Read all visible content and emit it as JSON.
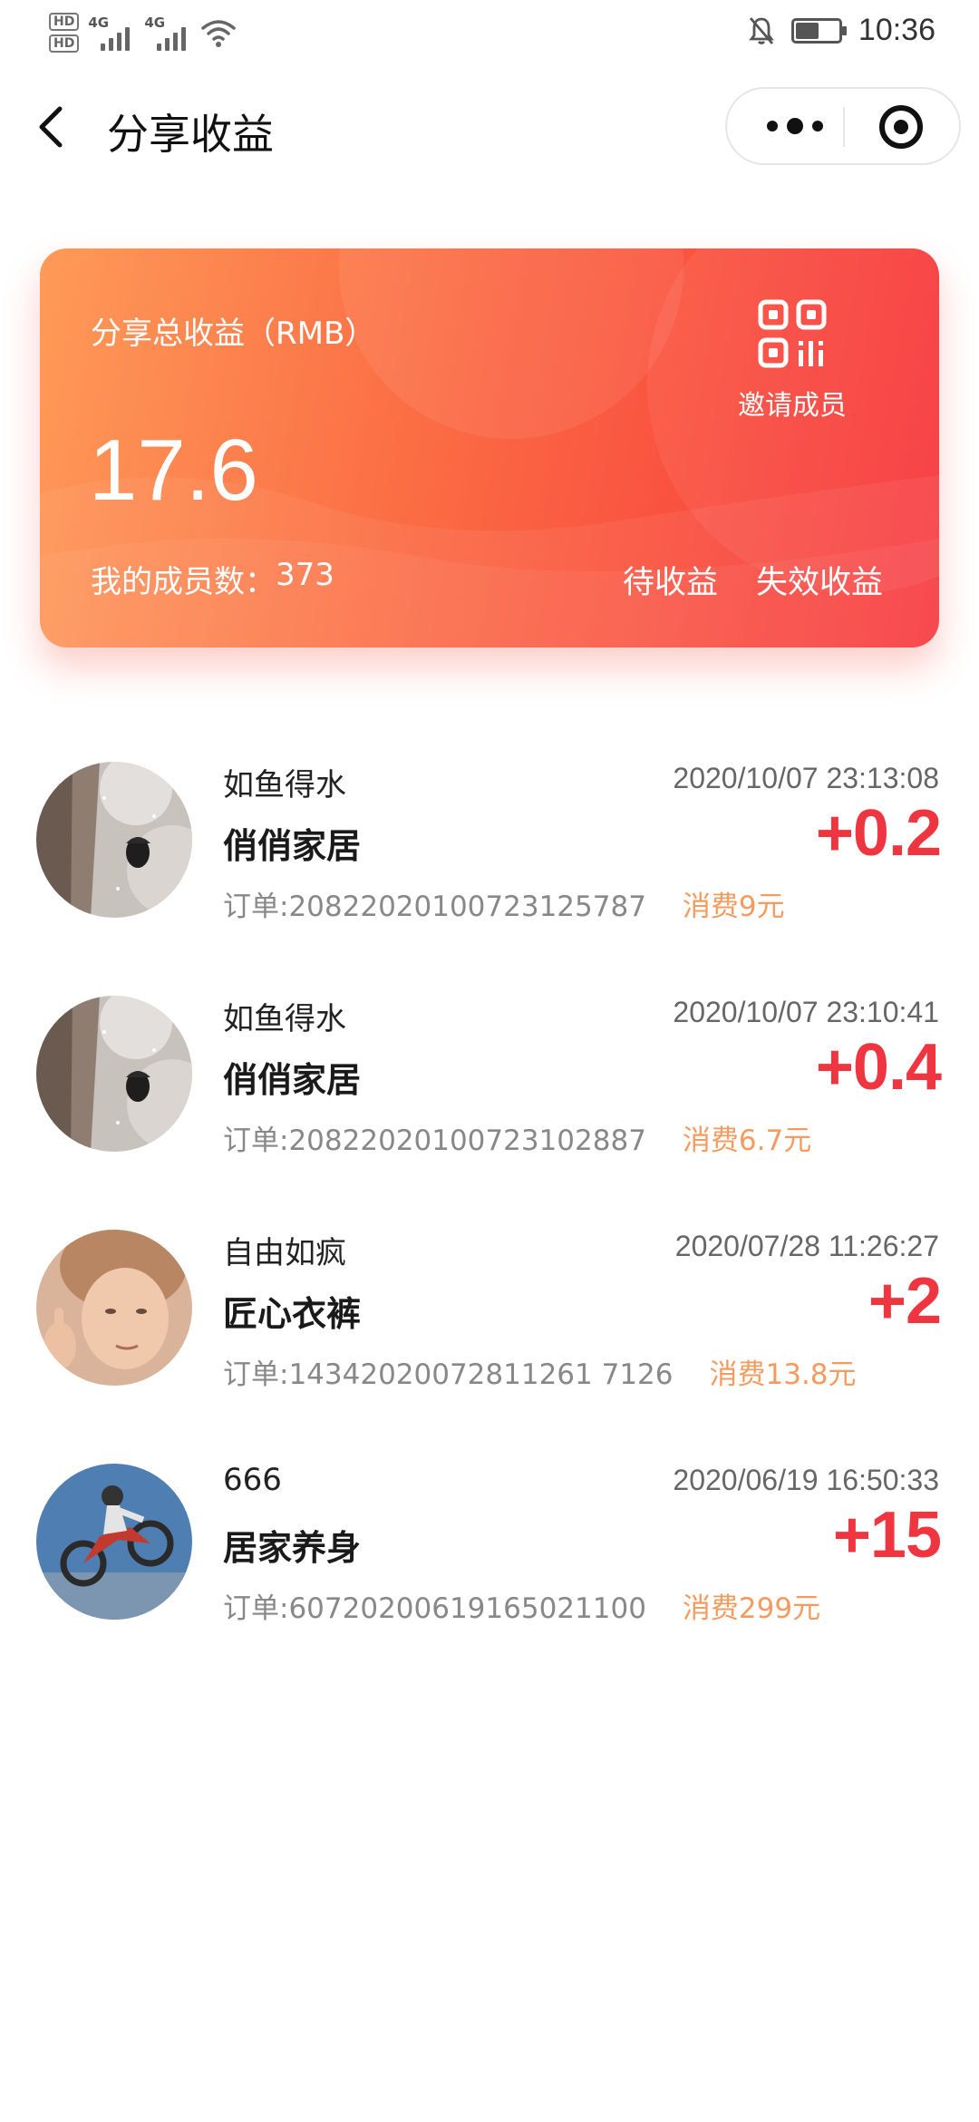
{
  "status_bar": {
    "hd1": "HD",
    "hd2": "HD",
    "net1": "4G",
    "net2": "4G",
    "time": "10:36",
    "battery_level": 0.55
  },
  "nav": {
    "title": "分享收益",
    "icons": [
      "back-arrow-icon",
      "more-dots-icon",
      "target-icon"
    ]
  },
  "summary": {
    "label": "分享总收益（RMB）",
    "amount": "17.6",
    "members_label": "我的成员数：",
    "members_count": "373",
    "invite_label": "邀请成员",
    "pending_label": "待收益",
    "expired_label": "失效收益",
    "colors": {
      "gradient_start": "#fe9a58",
      "gradient_end": "#f7353c"
    }
  },
  "records": [
    {
      "name": "如鱼得水",
      "date": "2020/10/07 23:13:08",
      "shop": "俏俏家居",
      "amount": "+0.2",
      "order_label": "订单:",
      "order_no": "20822020100723125787",
      "spend": "消费9元",
      "avatar": "snow-tree-avatar"
    },
    {
      "name": "如鱼得水",
      "date": "2020/10/07 23:10:41",
      "shop": "俏俏家居",
      "amount": "+0.4",
      "order_label": "订单:",
      "order_no": "20822020100723102887",
      "spend": "消费6.7元",
      "avatar": "snow-tree-avatar"
    },
    {
      "name": "自由如疯",
      "date": "2020/07/28 11:26:27",
      "shop": "匠心衣裤",
      "amount": "+2",
      "order_label": "订单:",
      "order_no": "14342020072811261 7126",
      "spend": "消费13.8元",
      "avatar": "child-thumbs-up-avatar"
    },
    {
      "name": "666",
      "date": "2020/06/19 16:50:33",
      "shop": "居家养身",
      "amount": "+15",
      "order_label": "订单:",
      "order_no": "60720200619165021100",
      "spend": "消费299元",
      "avatar": "motocross-avatar"
    }
  ],
  "colors": {
    "amount": "#ee3540",
    "spend": "#f59b5f"
  }
}
